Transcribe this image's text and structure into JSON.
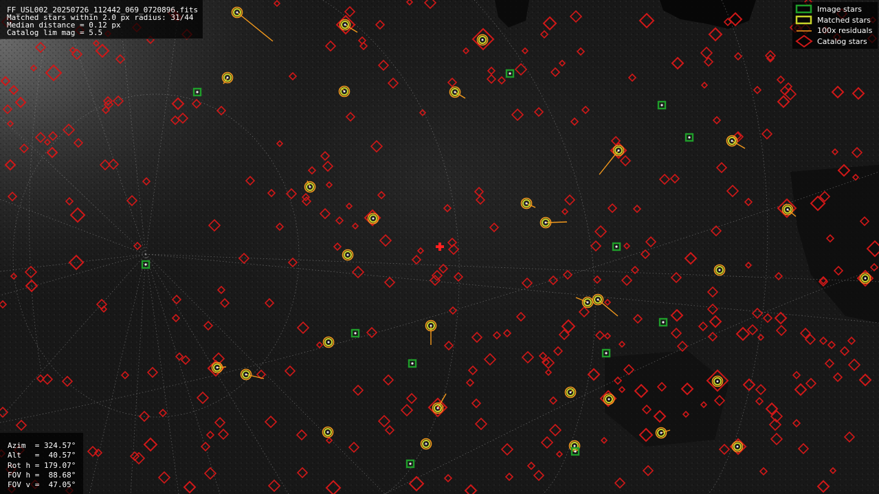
{
  "header": {
    "filename": "FF_USL002_20250726_112442_069_0720896.fits",
    "matched_line": "Matched stars within 2.0 px radius: 31/44",
    "median_line": "Median distance = 0.12 px",
    "catalog_line": "Catalog lim mag = 5.5"
  },
  "pointing": {
    "azim": "Azim  = 324.57°",
    "alt": "Alt   =  40.57°",
    "rot": "Rot h = 179.07°",
    "fov_h": "FOV h =  88.68°",
    "fov_v": "FOV v =  47.05°"
  },
  "legend": {
    "image_stars": "Image stars",
    "matched_stars": "Matched stars",
    "residuals": "100x residuals",
    "catalog_stars": "Catalog stars"
  },
  "colors": {
    "catalog": "#d01818",
    "image_star": "#1f9e2a",
    "matched": "#c8d42a",
    "residual": "#f59a1c",
    "center_marker": "#ff2020",
    "grid": "#9a9a9a"
  },
  "icons": {
    "center": "red-cross-icon",
    "image_star": "green-square-icon",
    "matched_star": "yellow-circle-icon",
    "catalog_star": "red-diamond-icon"
  }
}
